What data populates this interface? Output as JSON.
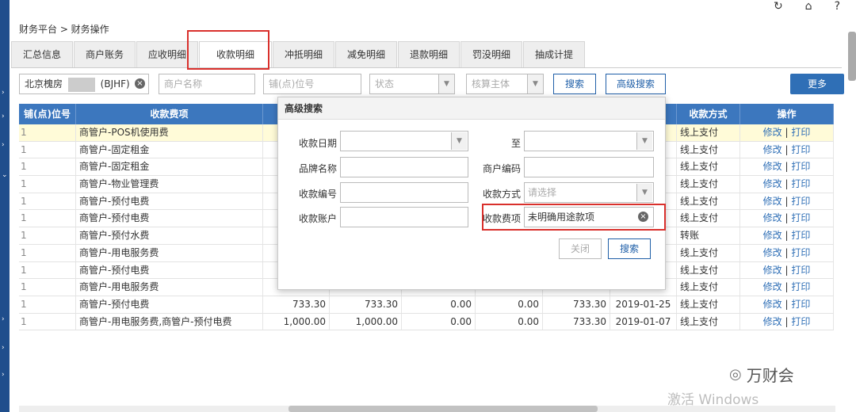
{
  "top_icons": {
    "history": "↻",
    "home": "⌂",
    "help": "?"
  },
  "breadcrumb": "财务平台 > 财务操作",
  "tabs": [
    "汇总信息",
    "商户账务",
    "应收明细",
    "收款明细",
    "冲抵明细",
    "减免明细",
    "退款明细",
    "罚没明细",
    "抽成计提"
  ],
  "filters": {
    "project_value": "北京槐房",
    "project_code": "(BJHF)",
    "merchant_placeholder": "商户名称",
    "position_placeholder": "铺(点)位号",
    "status_placeholder": "状态",
    "entity_placeholder": "核算主体",
    "search_label": "搜索",
    "advanced_label": "高级搜索",
    "more_label": "更多"
  },
  "table": {
    "headers": {
      "pos": "铺(点)位号",
      "item": "收款费项",
      "method": "收款方式",
      "op": "操作"
    },
    "edit_label": "修改",
    "print_label": "打印",
    "rows": [
      {
        "pos": "1",
        "item": "商管户-POS机使用费",
        "a": "",
        "b": "",
        "c": "",
        "d": "",
        "e": "",
        "date": "",
        "method": "线上支付"
      },
      {
        "pos": "1",
        "item": "商管户-固定租金",
        "a": "",
        "b": "",
        "c": "",
        "d": "",
        "e": "",
        "date": "",
        "method": "线上支付"
      },
      {
        "pos": "1",
        "item": "商管户-固定租金",
        "a": "",
        "b": "",
        "c": "",
        "d": "",
        "e": "",
        "date": "",
        "method": "线上支付"
      },
      {
        "pos": "1",
        "item": "商管户-物业管理费",
        "a": "",
        "b": "",
        "c": "",
        "d": "",
        "e": "",
        "date": "",
        "method": "线上支付"
      },
      {
        "pos": "1",
        "item": "商管户-预付电费",
        "a": "",
        "b": "",
        "c": "",
        "d": "",
        "e": "",
        "date": "",
        "method": "线上支付"
      },
      {
        "pos": "1",
        "item": "商管户-预付电费",
        "a": "",
        "b": "",
        "c": "",
        "d": "",
        "e": "",
        "date": "",
        "method": "线上支付"
      },
      {
        "pos": "1",
        "item": "商管户-预付水费",
        "a": "",
        "b": "",
        "c": "",
        "d": "",
        "e": "",
        "date": "",
        "method": "转账"
      },
      {
        "pos": "1",
        "item": "商管户-用电服务费",
        "a": "",
        "b": "",
        "c": "",
        "d": "",
        "e": "",
        "date": "",
        "method": "线上支付"
      },
      {
        "pos": "1",
        "item": "商管户-预付电费",
        "a": "",
        "b": "",
        "c": "",
        "d": "",
        "e": "",
        "date": "",
        "method": "线上支付"
      },
      {
        "pos": "1",
        "item": "商管户-用电服务费",
        "a": "",
        "b": "",
        "c": "",
        "d": "",
        "e": "",
        "date": "",
        "method": "线上支付"
      },
      {
        "pos": "1",
        "item": "商管户-预付电费",
        "a": "733.30",
        "b": "733.30",
        "c": "0.00",
        "d": "0.00",
        "e": "733.30",
        "date": "2019-01-25",
        "method": "线上支付"
      },
      {
        "pos": "1",
        "item": "商管户-用电服务费,商管户-预付电费",
        "a": "1,000.00",
        "b": "1,000.00",
        "c": "0.00",
        "d": "0.00",
        "e": "733.30",
        "date": "2019-01-07",
        "method": "线上支付"
      }
    ]
  },
  "modal": {
    "title": "高级搜索",
    "date_label": "收款日期",
    "to_label": "至",
    "brand_label": "品牌名称",
    "merchant_code_label": "商户编码",
    "receipt_no_label": "收款编号",
    "method_label": "收款方式",
    "method_placeholder": "请选择",
    "account_label": "收款账户",
    "fee_item_label": "收款费项",
    "fee_item_value": "未明确用途款项",
    "close_label": "关闭",
    "search_label": "搜索"
  },
  "watermark": {
    "brand": "万财会",
    "windows_activate": "激活 Windows"
  },
  "colors": {
    "header_blue": "#3c77be",
    "highlight_red": "#d9302c",
    "link_blue": "#2f6fb6"
  }
}
